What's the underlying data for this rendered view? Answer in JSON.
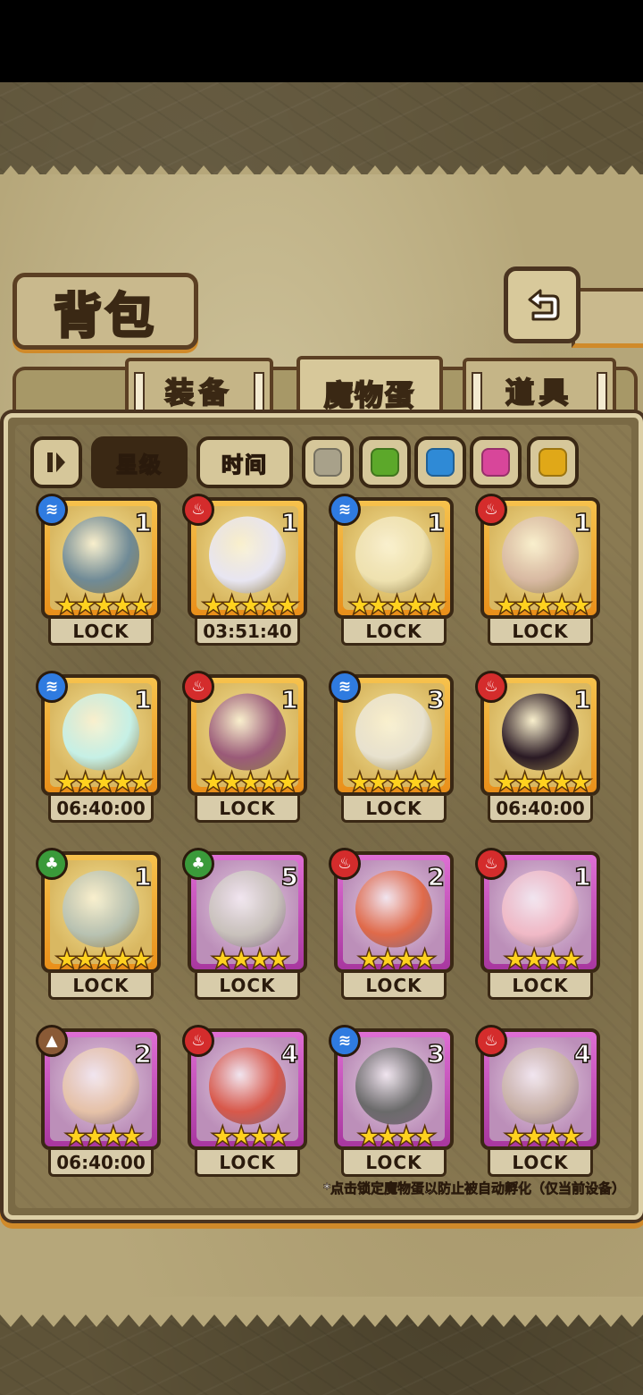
{
  "title": "背包",
  "tabs": [
    {
      "label": "装备",
      "active": false
    },
    {
      "label": "魔物蛋",
      "active": true
    },
    {
      "label": "道具",
      "active": false
    }
  ],
  "sort": {
    "star_label": "星级",
    "time_label": "时间",
    "selected": "星级"
  },
  "color_filters": [
    "#a8a18a",
    "#5ca82a",
    "#2f8ad6",
    "#d8469a",
    "#e0a818"
  ],
  "eggs": [
    {
      "element": "water",
      "count": "1",
      "stars": 5,
      "rarity": "gold",
      "status": "LOCK",
      "art": "#6f8a96"
    },
    {
      "element": "fire",
      "count": "1",
      "stars": 5,
      "rarity": "gold",
      "status": "03:51:40",
      "art": "#e8e6f2"
    },
    {
      "element": "water",
      "count": "1",
      "stars": 5,
      "rarity": "gold",
      "status": "LOCK",
      "art": "#efe2b0"
    },
    {
      "element": "fire",
      "count": "1",
      "stars": 5,
      "rarity": "gold",
      "status": "LOCK",
      "art": "#d8b9a2"
    },
    {
      "element": "water",
      "count": "1",
      "stars": 5,
      "rarity": "gold",
      "status": "06:40:00",
      "art": "#c6f0e6"
    },
    {
      "element": "fire",
      "count": "1",
      "stars": 5,
      "rarity": "gold",
      "status": "LOCK",
      "art": "#9a5a78"
    },
    {
      "element": "water",
      "count": "3",
      "stars": 5,
      "rarity": "gold",
      "status": "LOCK",
      "art": "#e8e2cf"
    },
    {
      "element": "fire",
      "count": "1",
      "stars": 5,
      "rarity": "gold",
      "status": "06:40:00",
      "art": "#2a1a24"
    },
    {
      "element": "grass",
      "count": "1",
      "stars": 5,
      "rarity": "gold",
      "status": "LOCK",
      "art": "#b8c2b2"
    },
    {
      "element": "grass",
      "count": "5",
      "stars": 4,
      "rarity": "purple",
      "status": "LOCK",
      "art": "#c9c2bc"
    },
    {
      "element": "fire",
      "count": "2",
      "stars": 4,
      "rarity": "purple",
      "status": "LOCK",
      "art": "#e06a4a"
    },
    {
      "element": "fire",
      "count": "1",
      "stars": 4,
      "rarity": "purple",
      "status": "LOCK",
      "art": "#f0b9c6"
    },
    {
      "element": "earth",
      "count": "2",
      "stars": 4,
      "rarity": "purple",
      "status": "06:40:00",
      "art": "#e6c2a8"
    },
    {
      "element": "fire",
      "count": "4",
      "stars": 4,
      "rarity": "purple",
      "status": "LOCK",
      "art": "#d8584a"
    },
    {
      "element": "water",
      "count": "3",
      "stars": 4,
      "rarity": "purple",
      "status": "LOCK",
      "art": "#6a6a6a"
    },
    {
      "element": "fire",
      "count": "4",
      "stars": 4,
      "rarity": "purple",
      "status": "LOCK",
      "art": "#c9b2a8"
    }
  ],
  "footer_note": "*点击锁定魔物蛋以防止被自动孵化（仅当前设备）",
  "icons": {
    "back": "back-arrow-icon",
    "filter_toggle": "filter-toggle-icon",
    "water": "water-wave-icon",
    "fire": "flame-icon",
    "grass": "leaf-icon",
    "earth": "mountain-icon"
  }
}
